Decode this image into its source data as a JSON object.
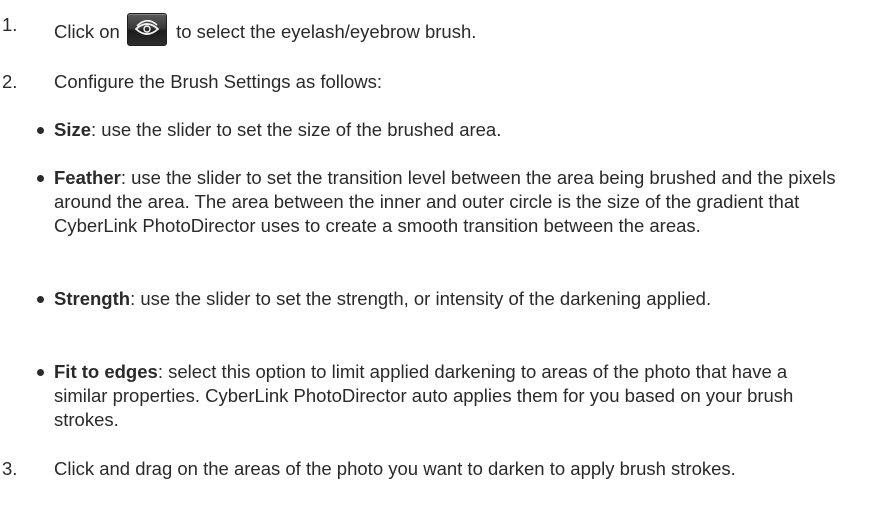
{
  "steps": [
    {
      "number": "1.",
      "before_icon": "Click on",
      "icon": "eyelash-brush-icon",
      "after_icon": "to select the eyelash/eyebrow brush."
    },
    {
      "number": "2.",
      "text": "Configure the Brush Settings as follows:"
    },
    {
      "number": "3.",
      "text": "Click and drag on the areas of the photo you want to darken to apply brush strokes."
    }
  ],
  "settings": [
    {
      "term": "Size",
      "description": ": use the slider to set the size of the brushed area."
    },
    {
      "term": "Feather",
      "description": ": use the slider to set the transition level between the area being brushed and the pixels around the area. The area between the inner and outer circle is the size of the gradient that CyberLink PhotoDirector uses to create a smooth transition between the areas."
    },
    {
      "term": "Strength",
      "description": ": use the slider to set the strength, or intensity of the darkening applied."
    },
    {
      "term": "Fit to edges",
      "description": ": select this option to limit applied darkening to areas of the photo that have a similar properties. CyberLink PhotoDirector auto applies them for you based on your brush strokes."
    }
  ]
}
